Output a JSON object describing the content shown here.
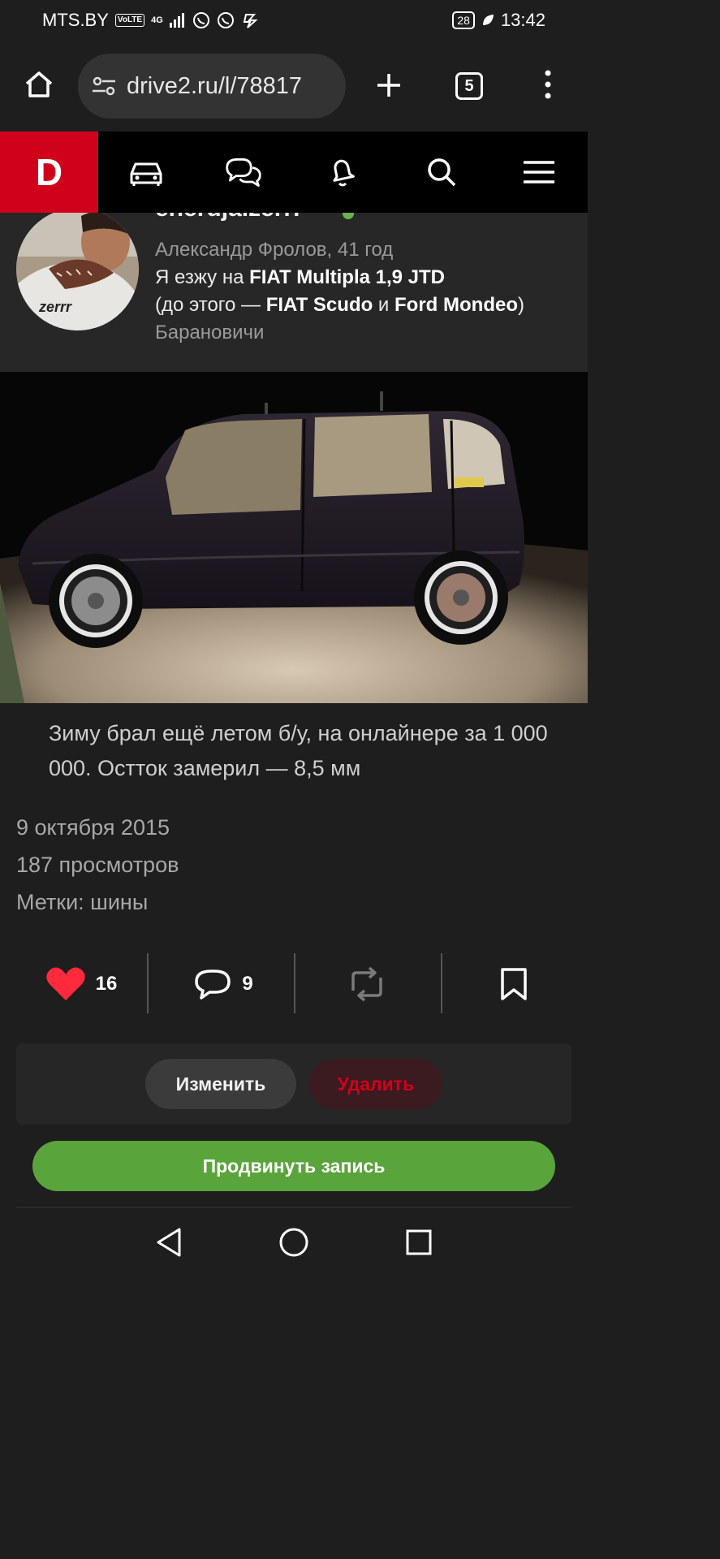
{
  "status_bar": {
    "carrier": "MTS.BY",
    "volte": "VoLTE",
    "network": "4G",
    "battery": "28",
    "time": "13:42"
  },
  "browser": {
    "url": "drive2.ru/l/78817",
    "tab_count": "5"
  },
  "site": {
    "logo": "D"
  },
  "profile": {
    "username": "enerdjaizerrr",
    "name_age": "Александр Фролов, 41 год",
    "drives_prefix": "Я езжу на ",
    "drives_car": "FIAT Multipla 1,9 JTD",
    "before_prefix": "(до этого — ",
    "before_car1": "FIAT Scudo",
    "before_and": " и ",
    "before_car2": "Ford Mondeo",
    "before_suffix": ")",
    "city": "Барановичи"
  },
  "post": {
    "caption": "Зиму брал ещё летом б/у, на онлайнере за 1 000 000. Остток замерил — 8,5 мм",
    "date": "9 октября 2015",
    "views": "187 просмотров",
    "tags": "Метки: шины"
  },
  "actions": {
    "likes": "16",
    "comments": "9"
  },
  "buttons": {
    "edit": "Изменить",
    "delete": "Удалить",
    "promote": "Продвинуть запись"
  },
  "colors": {
    "brand": "#d0021b",
    "like": "#ff2a3c",
    "promote": "#5aa43c",
    "online": "#6ab04c"
  }
}
